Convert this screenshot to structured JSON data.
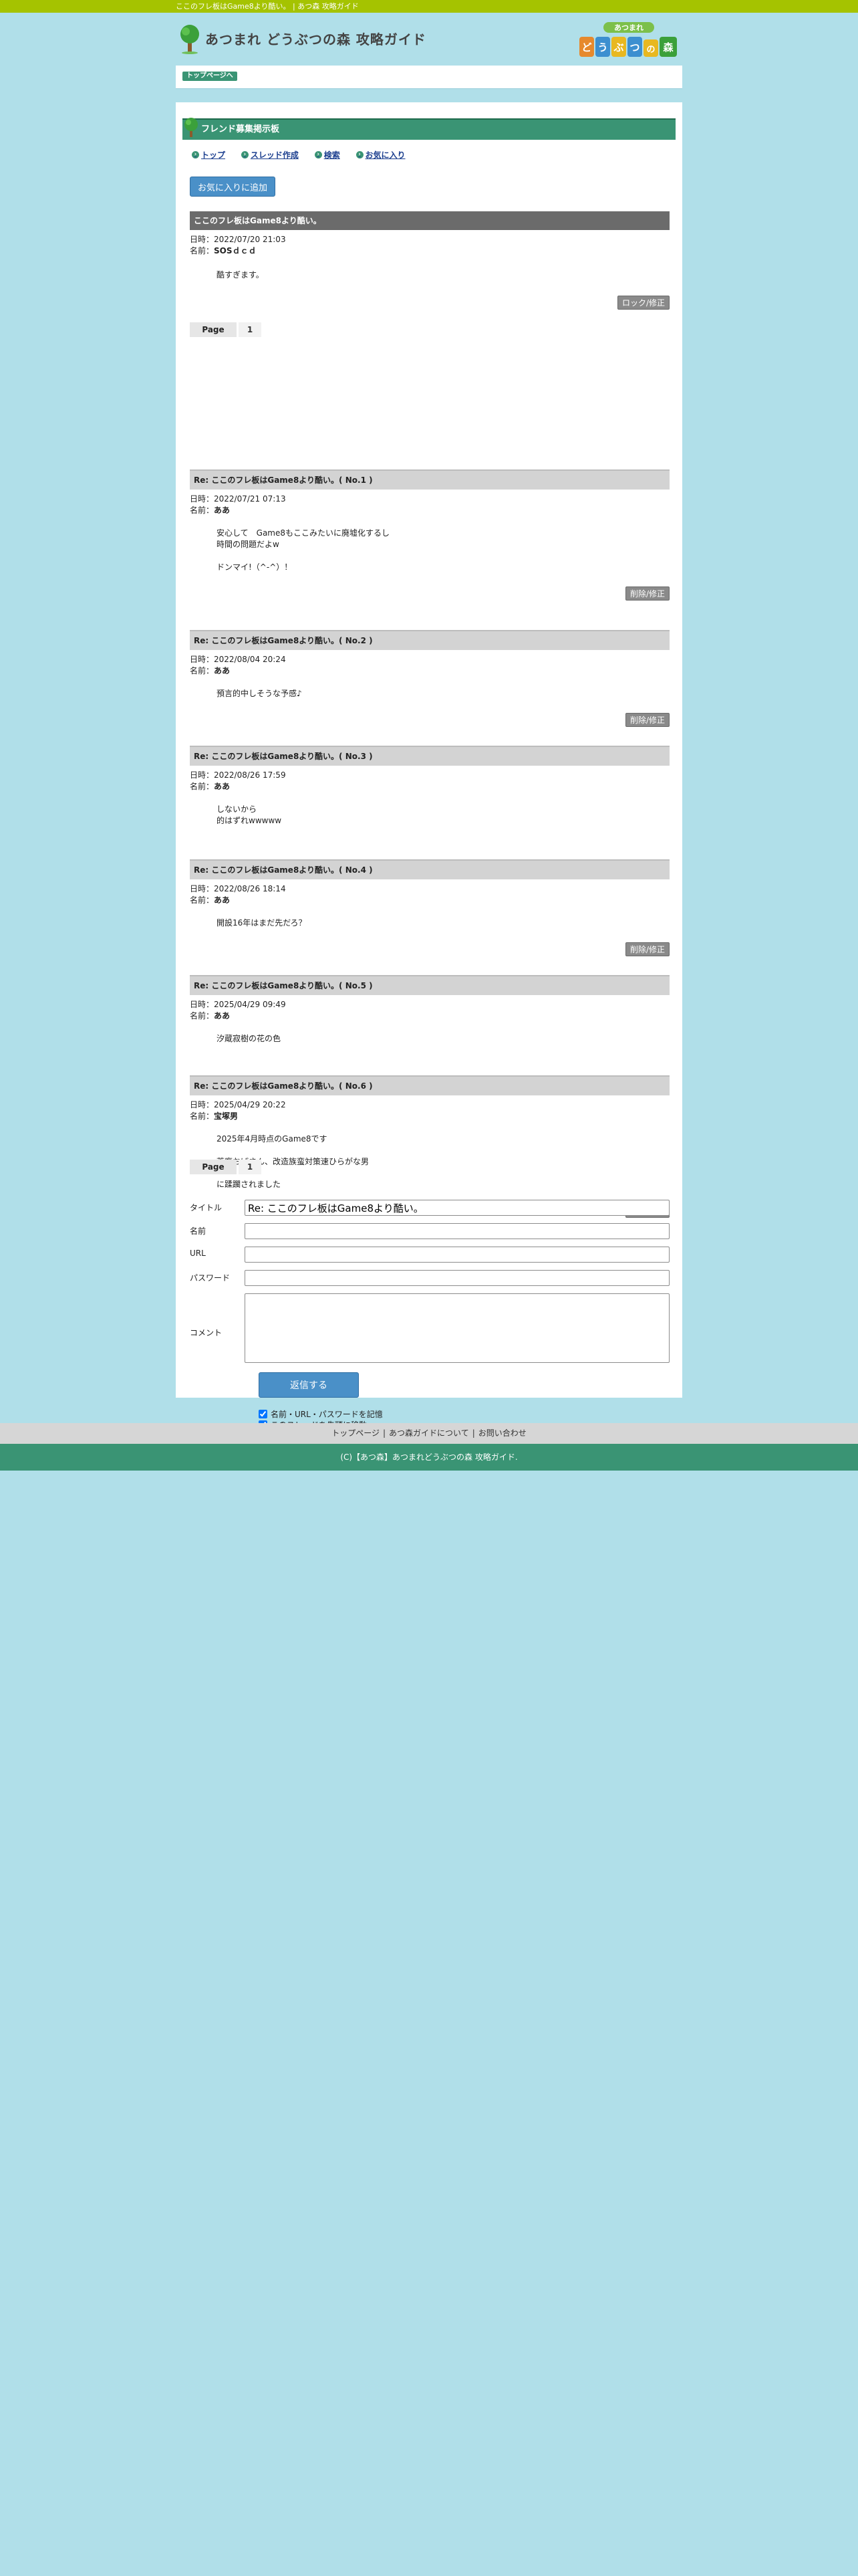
{
  "topbar": {
    "text": "ここのフレ板はGame8より酷い。 | あつ森 攻略ガイド"
  },
  "header": {
    "site_title": "あつまれ どうぶつの森 攻略ガイド",
    "badge_top": "あつまれ",
    "badge_chars": [
      "ど",
      "う",
      "ぶ",
      "つ",
      "の",
      "森"
    ]
  },
  "breadcrumb": {
    "top_page": "トップページへ"
  },
  "board": {
    "title": "フレンド募集掲示板",
    "nav": [
      "トップ",
      "スレッド作成",
      "検索",
      "お気に入り"
    ],
    "favorite_button": "お気に入りに追加"
  },
  "thread": {
    "title": "ここのフレ板はGame8より酷い。",
    "date_label": "日時：",
    "name_label": "名前：",
    "date": "2022/07/20 21:03",
    "name": "SOSｄｃｄ",
    "body": "酷すぎます。",
    "lock_button": "ロック/修正",
    "delete_button": "削除/修正",
    "pager": {
      "label": "Page",
      "pages": [
        "1"
      ]
    }
  },
  "replies": [
    {
      "title": "Re: ここのフレ板はGame8より酷い。( No.1 )",
      "date": "2022/07/21 07:13",
      "name": "ああ",
      "body": "安心して　Game8もここみたいに廃墟化するし\n時間の問題だよw\n\nドンマイ!（^-^）！",
      "has_button": true
    },
    {
      "title": "Re: ここのフレ板はGame8より酷い。( No.2 )",
      "date": "2022/08/04 20:24",
      "name": "ああ",
      "body": "預言的中しそうな予感♪",
      "has_button": true
    },
    {
      "title": "Re: ここのフレ板はGame8より酷い。( No.3 )",
      "date": "2022/08/26 17:59",
      "name": "ああ",
      "body": "しないから\n的はずれwwwww",
      "has_button": false
    },
    {
      "title": "Re: ここのフレ板はGame8より酷い。( No.4 )",
      "date": "2022/08/26 18:14",
      "name": "ああ",
      "body": "開設16年はまだ先だろ？",
      "has_button": true
    },
    {
      "title": "Re: ここのフレ板はGame8より酷い。( No.5 )",
      "date": "2025/04/29 09:49",
      "name": "ああ",
      "body": "汐蔵寂樹の花の色",
      "has_button": false
    },
    {
      "title": "Re: ここのフレ板はGame8より酷い。( No.6 )",
      "date": "2025/04/29 20:22",
      "name": "宝塚男",
      "body": "2025年4月時点のGame8です\n\n荒廃おばさん、改造族蛮対策速ひらがな男\n\nに蹂躙されました",
      "has_button": true
    }
  ],
  "form": {
    "title_label": "タイトル",
    "title_value": "Re: ここのフレ板はGame8より酷い。",
    "name_label": "名前",
    "url_label": "URL",
    "password_label": "パスワード",
    "comment_label": "コメント",
    "submit": "返信する",
    "remember": "名前・URL・パスワードを記憶",
    "move_top": "このスレッドを先頭に移動"
  },
  "footer": {
    "links": [
      "トップページ",
      "あつ森ガイドについて",
      "お問い合わせ"
    ],
    "copyright": "(C)【あつ森】あつまれどうぶつの森 攻略ガイド."
  },
  "colors": {
    "accent_green": "#3a9474",
    "topbar_green": "#a5c300",
    "background": "#b0dfe9",
    "button_blue": "#4a90c8"
  }
}
